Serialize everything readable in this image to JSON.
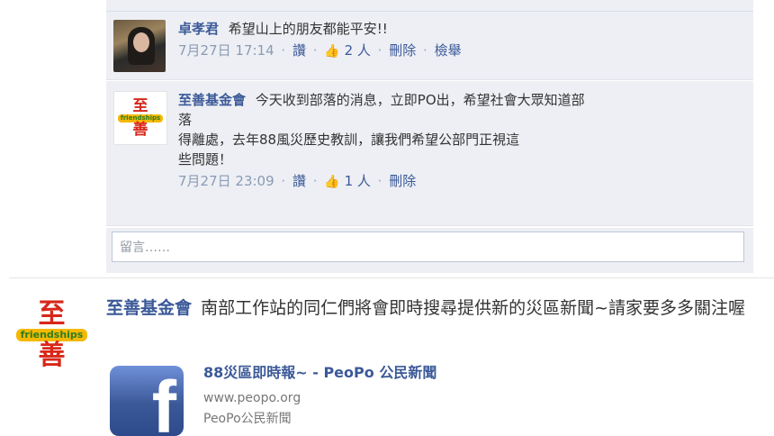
{
  "comments": [
    {
      "author": "卓孝君",
      "text_lines": [
        "希望山上的朋友都能平安!!"
      ],
      "time": "7月27日 17:14",
      "like": "讚",
      "like_count": "2 人",
      "actions": [
        "刪除",
        "檢舉"
      ]
    },
    {
      "author": "至善基金會",
      "text_lines": [
        "今天收到部落的消息，立即PO出，希望社會大眾知道部",
        "落",
        "得離處，去年88風災歷史教訓，讓我們希望公部門正視這",
        "些問題！"
      ],
      "time": "7月27日 23:09",
      "like": "讚",
      "like_count": "1 人",
      "actions": [
        "刪除"
      ]
    }
  ],
  "reply_placeholder": "留言……",
  "logo": {
    "top": "至",
    "mid": "friendships",
    "bottom": "善"
  },
  "post": {
    "author": "至善基金會",
    "text": "南部工作站的同仁們將會即時搜尋提供新的災區新聞~請家要多多關注喔"
  },
  "attachment": {
    "title": "88災區即時報~ - PeoPo 公民新聞",
    "url": "www.peopo.org",
    "source": "PeoPo公民新聞",
    "icon": "facebook-icon"
  },
  "colors": {
    "link": "#3b5998",
    "comment_bg": "#edeff4",
    "logo_red": "#d8271a"
  }
}
